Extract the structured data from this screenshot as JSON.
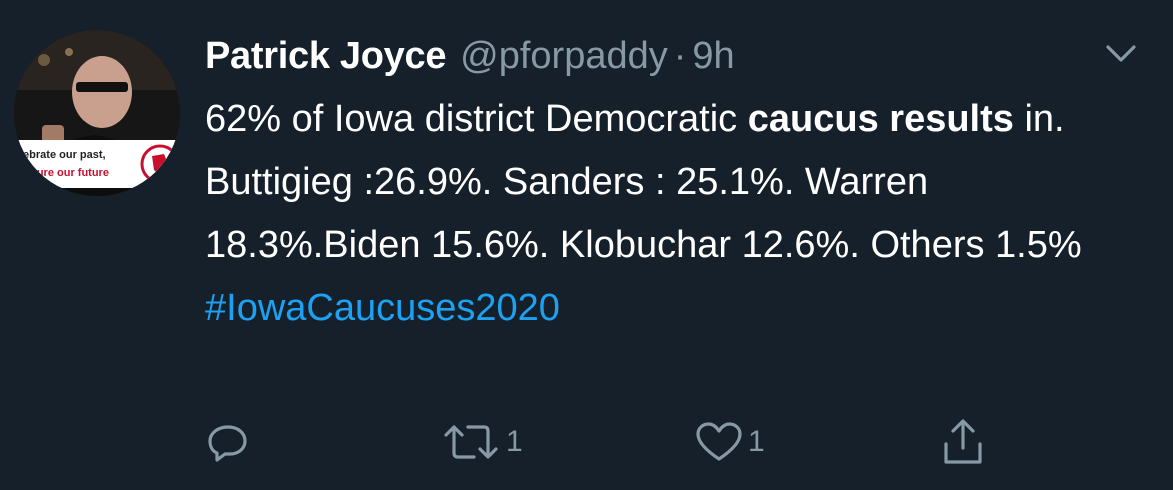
{
  "tweet": {
    "display_name": "Patrick Joyce",
    "handle": "@pforpaddy",
    "separator": "·",
    "time": "9h",
    "body": {
      "part1": "62% of Iowa district Democratic ",
      "bold1": "caucus",
      "part2": " ",
      "bold2": "results",
      "part3": " in. Buttigieg :26.9%. Sanders : 25.1%. Warren 18.3%.Biden 15.6%. Klobuchar 12.6%. Others 1.5%",
      "hashtag": "#IowaCaucuses2020"
    },
    "avatar": {
      "banner_line1": "lebrate our past,",
      "banner_line2": "nsure our future"
    },
    "actions": {
      "reply_icon": "reply-icon",
      "retweet_icon": "retweet-icon",
      "retweet_count": "1",
      "like_icon": "heart-icon",
      "like_count": "1",
      "share_icon": "share-icon"
    },
    "colors": {
      "background": "#15202b",
      "primary_text": "#ffffff",
      "secondary_text": "#8899a6",
      "link": "#1da1f2"
    }
  }
}
